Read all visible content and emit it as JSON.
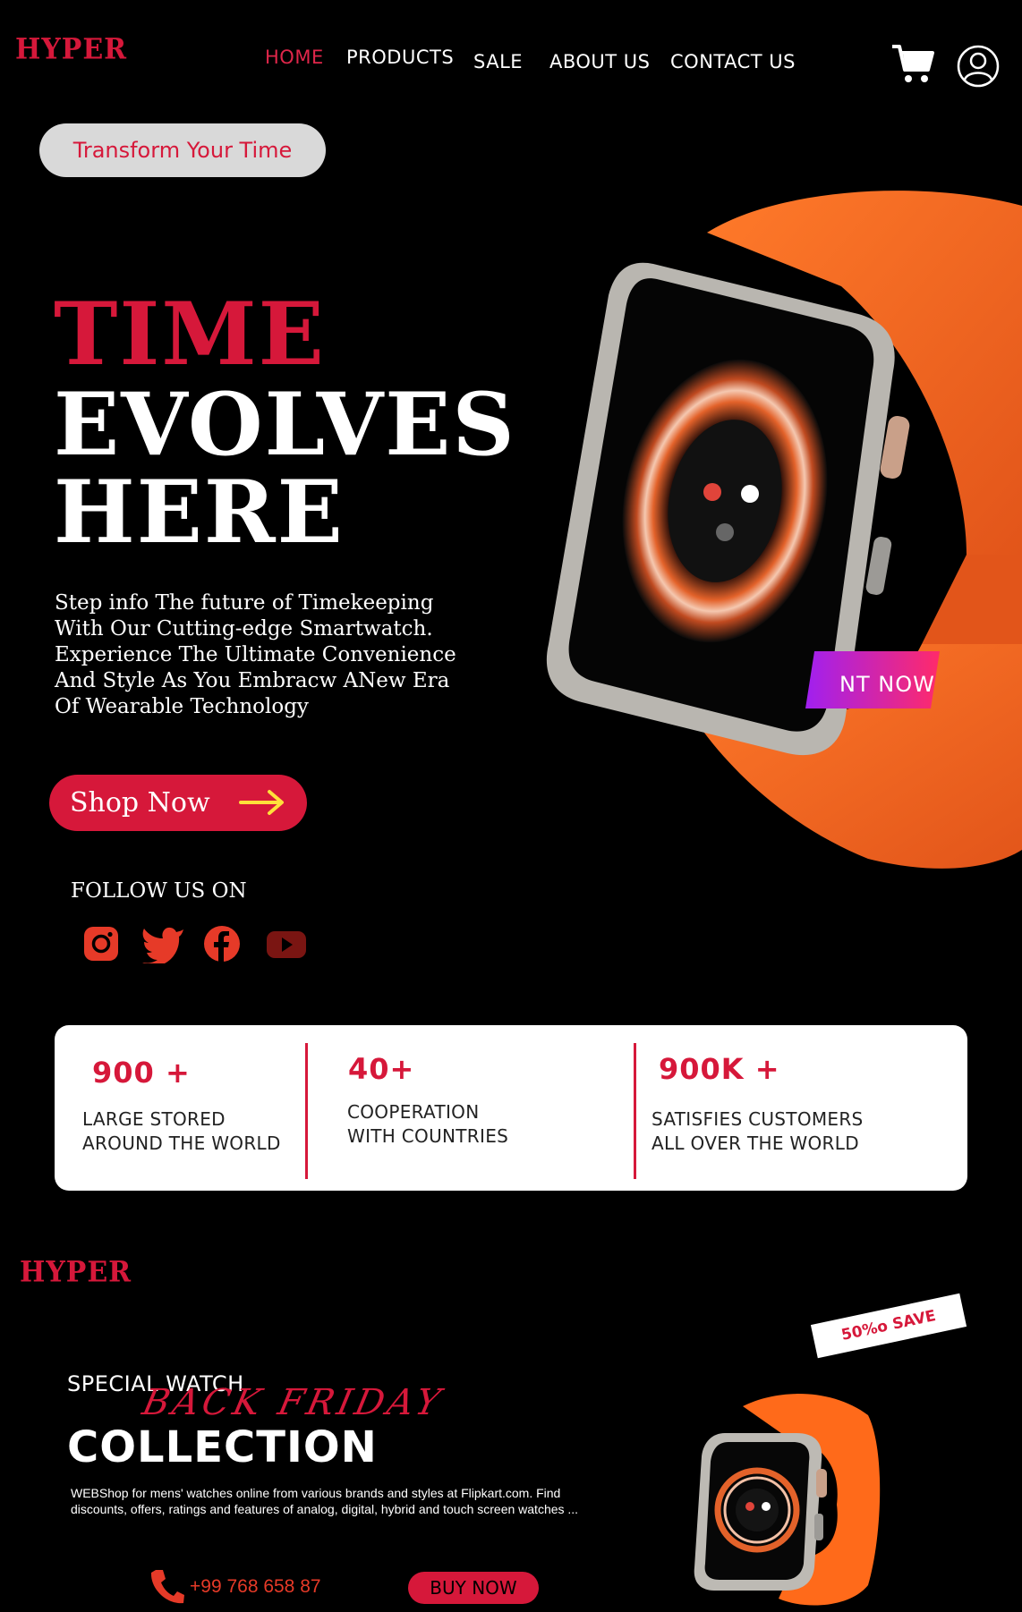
{
  "brand": {
    "logo": "HYPER"
  },
  "nav": {
    "items": [
      {
        "label": "HOME",
        "active": true
      },
      {
        "label": "PRODUCTS",
        "active": false
      },
      {
        "label": "SALE",
        "active": false
      },
      {
        "label": "ABOUT US",
        "active": false
      },
      {
        "label": "CONTACT US",
        "active": false
      }
    ],
    "icons": [
      "cart-icon",
      "user-icon"
    ]
  },
  "hero": {
    "tag": "Transform Your Time",
    "headline": [
      "TIME",
      "EVOLVES",
      "HERE"
    ],
    "description": "Step info The future of Timekeeping With Our Cutting-edge Smartwatch. Experience The Ultimate Convenience And Style As You Embracw ANew Era Of Wearable Technology",
    "cta": "Shop Now",
    "image_overlay_text": "NT NOW"
  },
  "follow": {
    "label": "FOLLOW US ON",
    "icons": [
      "instagram-icon",
      "twitter-icon",
      "facebook-icon",
      "youtube-icon"
    ]
  },
  "stats": [
    {
      "value": "900 +",
      "label_line1": "LARGE STORED",
      "label_line2": "AROUND THE WORLD"
    },
    {
      "value": "40+",
      "label_line1": "COOPERATION",
      "label_line2": "WITH COUNTRIES"
    },
    {
      "value": "900K +",
      "label_line1": "SATISFIES CUSTOMERS",
      "label_line2": "ALL OVER THE WORLD"
    }
  ],
  "promo": {
    "logo": "HYPER",
    "eyebrow": "SPECIAL WATCH",
    "script": "BACK FRIDAY",
    "title": "COLLECTION",
    "blurb_line1": "WEBShop for mens' watches online from various brands and styles at Flipkart.com. Find",
    "blurb_line2": "discounts, offers, ratings and features of analog, digital, hybrid and touch screen watches ...",
    "phone": "+99 768 658 87",
    "buy": "BUY NOW",
    "save_tag": "50%o SAVE"
  },
  "colors": {
    "accent": "#d6183a",
    "band": "#ff6a1a",
    "background": "#000000"
  }
}
